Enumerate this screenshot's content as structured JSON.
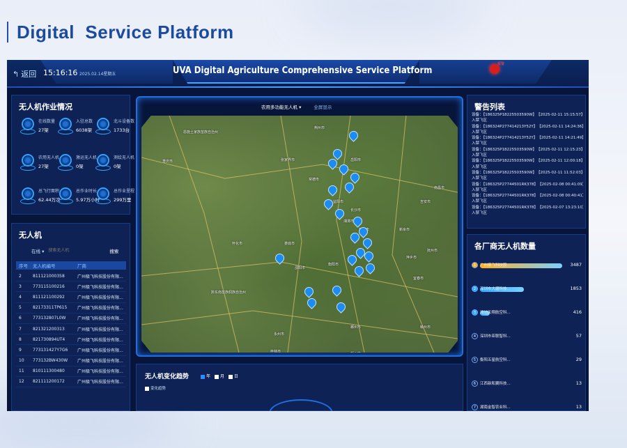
{
  "slide": {
    "title": "Digital  Service Platform"
  },
  "header": {
    "title": "UVA Digital Agriculture Comprehensive Service Platform",
    "back_label": "返回",
    "time": "15:16:16",
    "date": "2025.02.14星期五",
    "alarm_label": "报警"
  },
  "stats": {
    "title": "无人机作业情况",
    "items": [
      {
        "label": "在线数量",
        "value": "27架"
      },
      {
        "label": "入驻总数",
        "value": "6038架"
      },
      {
        "label": "北斗设备数",
        "value": "1733台"
      },
      {
        "label": "农用无人机",
        "value": "27架"
      },
      {
        "label": "激运无人机",
        "value": "0架"
      },
      {
        "label": "测绘无人机",
        "value": "0架"
      },
      {
        "label": "总飞行面积",
        "value": "62.44万次"
      },
      {
        "label": "总作业时长",
        "value": "5.97万小时"
      },
      {
        "label": "总作业里程",
        "value": "299万里"
      }
    ]
  },
  "drones": {
    "title": "无人机",
    "filter_value": "在线",
    "search_placeholder": "搜索无人机",
    "search_label": "搜索",
    "columns": [
      "序号",
      "无人机编号",
      "厂商"
    ],
    "rows": [
      {
        "no": "2",
        "id": "811121000358",
        "vendor": "广州极飞科技股份有限..."
      },
      {
        "no": "3",
        "id": "773115100216",
        "vendor": "广州极飞科技股份有限..."
      },
      {
        "no": "4",
        "id": "811121100292",
        "vendor": "广州极飞科技股份有限..."
      },
      {
        "no": "5",
        "id": "82173311TP615",
        "vendor": "广州极飞科技股份有限..."
      },
      {
        "no": "6",
        "id": "773132807L0W",
        "vendor": "广州极飞科技股份有限..."
      },
      {
        "no": "7",
        "id": "821321200313",
        "vendor": "广州极飞科技股份有限..."
      },
      {
        "no": "8",
        "id": "821730894UT4",
        "vendor": "广州极飞科技股份有限..."
      },
      {
        "no": "9",
        "id": "773131427Y7G6",
        "vendor": "广州极飞科技股份有限..."
      },
      {
        "no": "10",
        "id": "773132BW430W",
        "vendor": "广州极飞科技股份有限..."
      },
      {
        "no": "11",
        "id": "810111300480",
        "vendor": "广州极飞科技股份有限..."
      },
      {
        "no": "12",
        "id": "821111200172",
        "vendor": "广州极飞科技股份有限..."
      }
    ]
  },
  "map": {
    "select_label": "农用多功能无人机 ▾",
    "fullscreen_label": "全屏显示",
    "cities": [
      "重庆市",
      "荆州市",
      "岳阳市",
      "常德市",
      "益阳市",
      "长沙市",
      "株洲市",
      "湘潭市",
      "衡阳市",
      "邵阳市",
      "怀化市",
      "娄底市",
      "吉安市",
      "南昌市",
      "郴州市",
      "永州市",
      "桂林市",
      "贺州市",
      "黔东南苗族侗族自治州",
      "张家界市",
      "恩施土家族苗族自治州",
      "新余市",
      "萍乡市",
      "宜春市",
      "抚州市",
      "赣州市"
    ]
  },
  "trend": {
    "title": "无人机变化趋势",
    "options": [
      "年",
      "月",
      "日"
    ],
    "legend": "变化趋势"
  },
  "alerts": {
    "title": "警告列表",
    "rows": [
      {
        "device": "设备：【186325P18225503590W】",
        "time": "【2025-02-11 15:15:57】进"
      },
      {
        "device": "入禁飞区",
        "time": ""
      },
      {
        "device": "设备：【186324P277414213Y52Y】",
        "time": "【2025-02-11 14:24:36】进"
      },
      {
        "device": "入禁飞区",
        "time": ""
      },
      {
        "device": "设备：【186324P277414213Y52Y】",
        "time": "【2025-02-11 14:21:49】进"
      },
      {
        "device": "入禁飞区",
        "time": ""
      },
      {
        "device": "设备：【186325P18225503590W】",
        "time": "【2025-02-11 12:15:23】进"
      },
      {
        "device": "入禁飞区",
        "time": ""
      },
      {
        "device": "设备：【186325P18225503590W】",
        "time": "【2025-02-11 12:00:18】进"
      },
      {
        "device": "入禁飞区",
        "time": ""
      },
      {
        "device": "设备：【186325P18225503590W】",
        "time": "【2025-02-11 11:52:03】进"
      },
      {
        "device": "入禁飞区",
        "time": ""
      },
      {
        "device": "设备：【186325P27744501RK378】",
        "time": "【2025-02-08 00:41:09】进"
      },
      {
        "device": "入禁飞区",
        "time": ""
      },
      {
        "device": "设备：【186325P27744501RK378】",
        "time": "【2025-02-08 00:40:41】进"
      },
      {
        "device": "入禁飞区",
        "time": ""
      },
      {
        "device": "设备：【186325P27744501RK378】",
        "time": "【2025-02-07 13:23:10】进"
      },
      {
        "device": "入禁飞区",
        "time": ""
      }
    ]
  },
  "vendors": {
    "title": "各厂商无人机数量",
    "rows": [
      {
        "rank": "1",
        "name": "广州极飞科技股...",
        "value": 3487,
        "color": "#ffb020"
      },
      {
        "rank": "2",
        "name": "深圳市大疆科技...",
        "value": 1853,
        "color": "#2ea8ff"
      },
      {
        "rank": "3",
        "name": "潍坊天翔航空科...",
        "value": 416,
        "color": "#2ea8ff"
      },
      {
        "rank": "4",
        "name": "深圳市亚联智科...",
        "value": 57,
        "color": "#2ea8ff"
      },
      {
        "rank": "5",
        "name": "衡阳五星航空科...",
        "value": 29,
        "color": "#2ea8ff"
      },
      {
        "rank": "6",
        "name": "江西新和翼科技...",
        "value": 13,
        "color": "#2ea8ff"
      },
      {
        "rank": "7",
        "name": "湖南金智农业科...",
        "value": 13,
        "color": "#2ea8ff"
      }
    ]
  }
}
